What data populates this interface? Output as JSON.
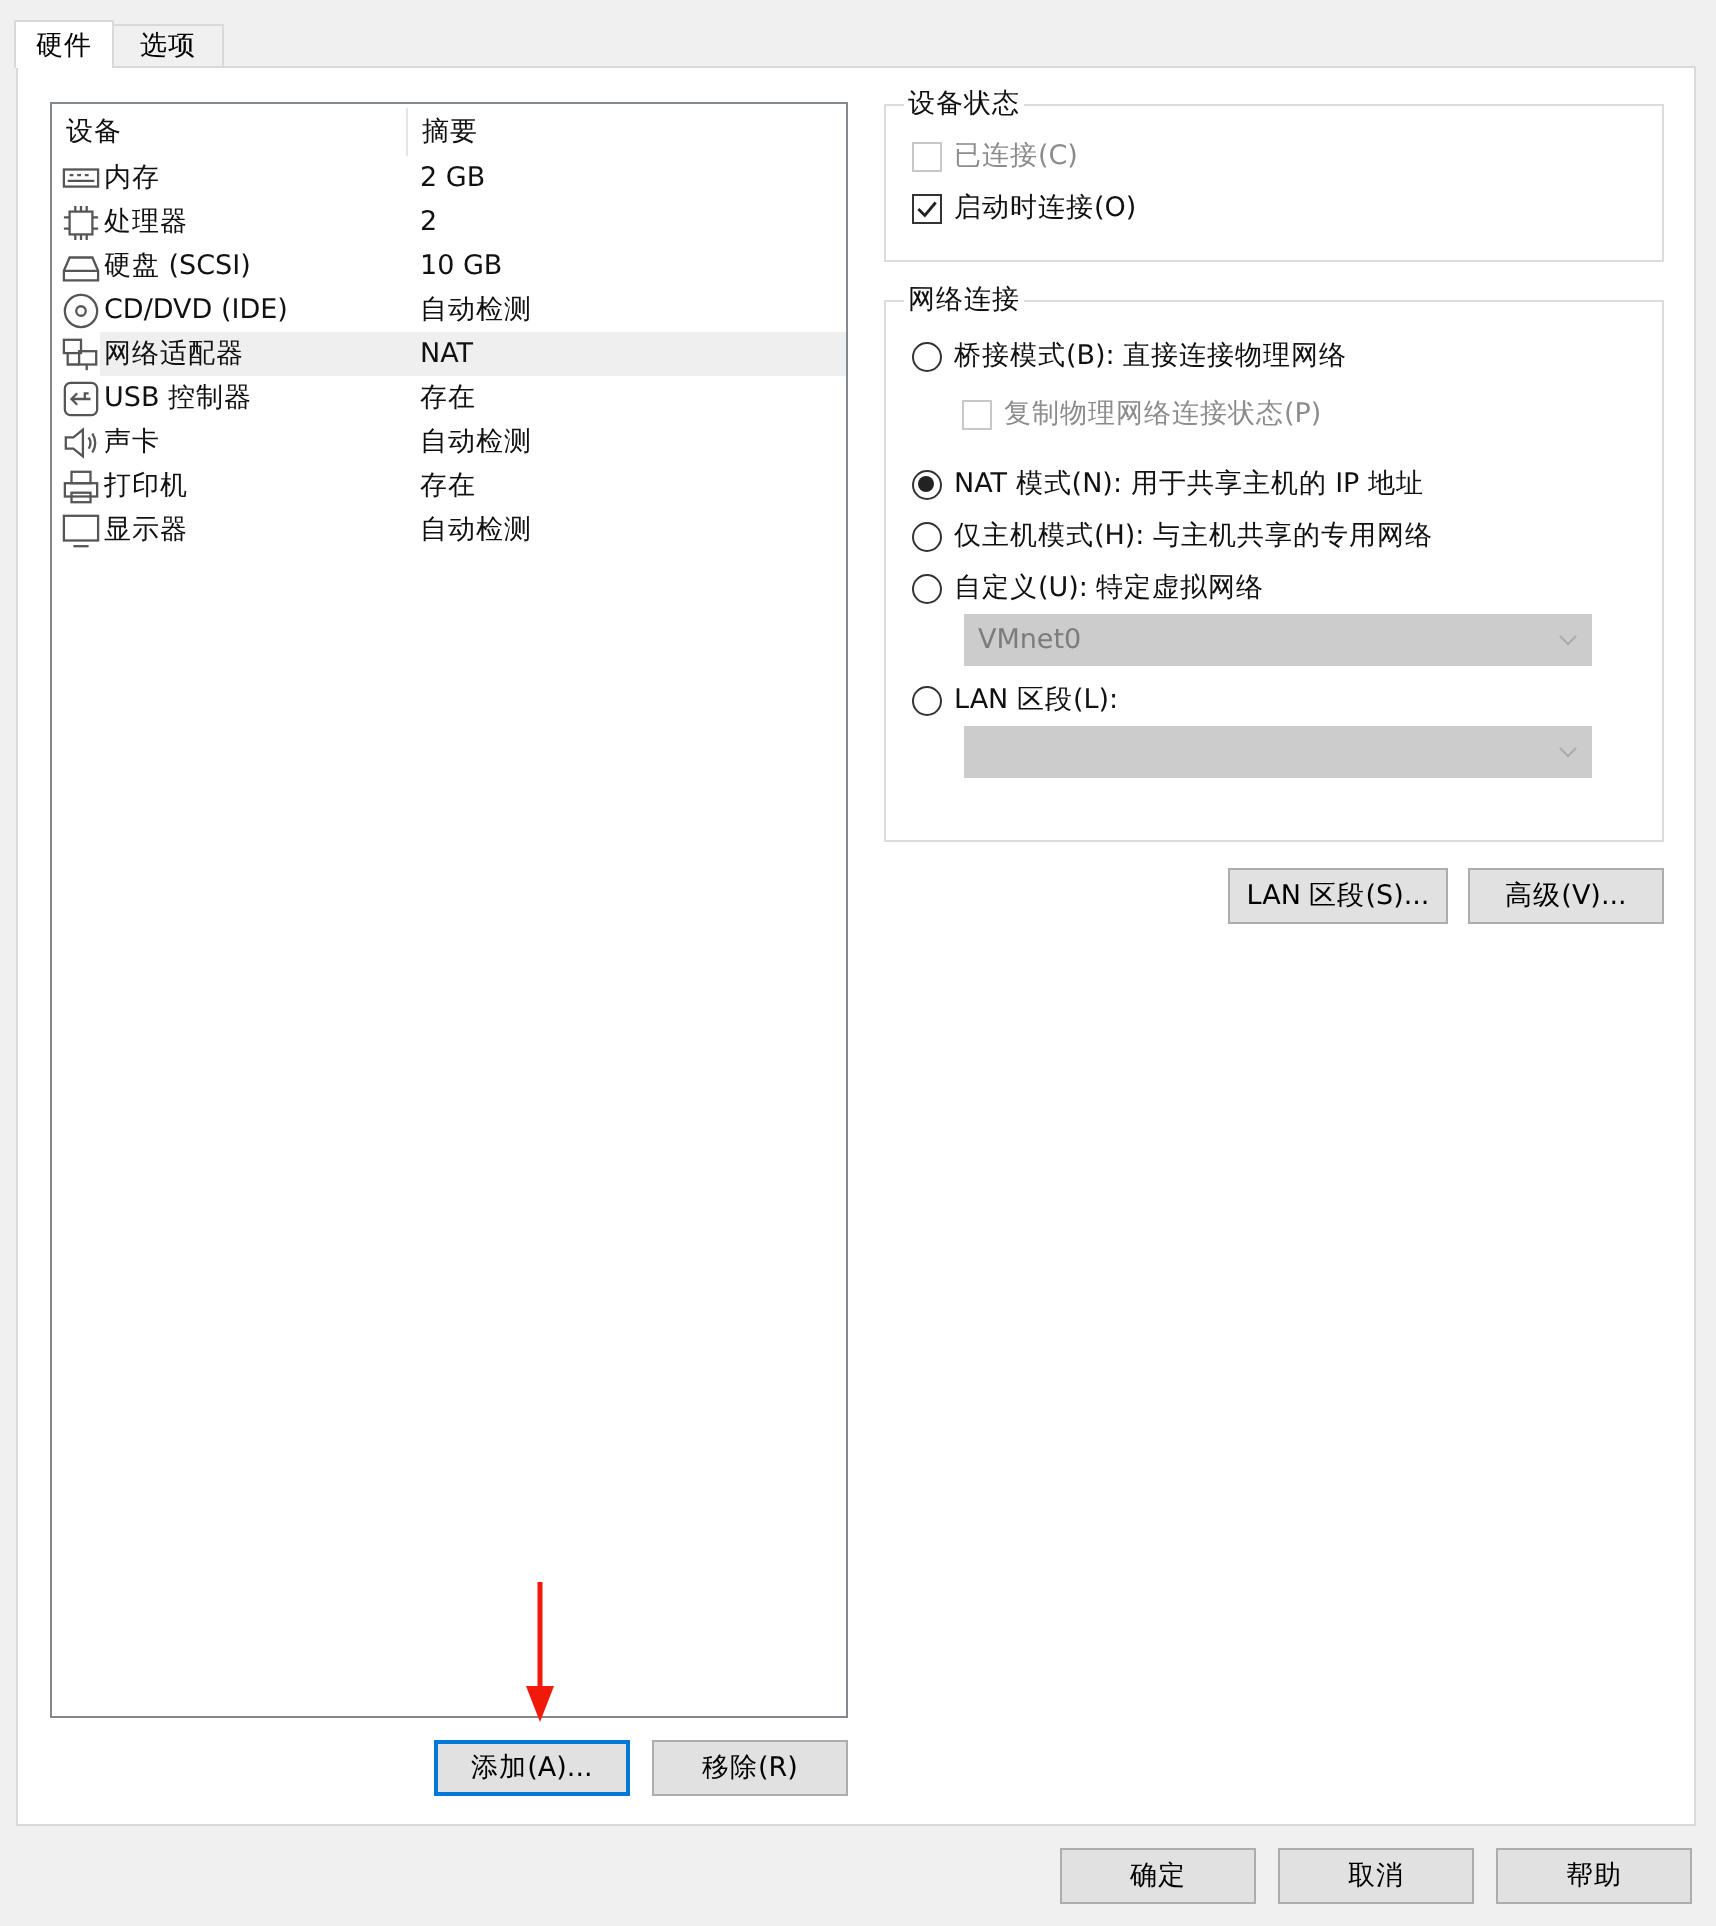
{
  "tabs": [
    {
      "label": "硬件",
      "selected": true
    },
    {
      "label": "选项",
      "selected": false
    }
  ],
  "devices": {
    "columns": [
      "设备",
      "摘要"
    ],
    "rows": [
      {
        "name": "内存",
        "summary": "2 GB",
        "selected": false
      },
      {
        "name": "处理器",
        "summary": "2",
        "selected": false
      },
      {
        "name": "硬盘 (SCSI)",
        "summary": "10 GB",
        "selected": false
      },
      {
        "name": "CD/DVD (IDE)",
        "summary": "自动检测",
        "selected": false
      },
      {
        "name": "网络适配器",
        "summary": "NAT",
        "selected": true
      },
      {
        "name": "USB 控制器",
        "summary": "存在",
        "selected": false
      },
      {
        "name": "声卡",
        "summary": "自动检测",
        "selected": false
      },
      {
        "name": "打印机",
        "summary": "存在",
        "selected": false
      },
      {
        "name": "显示器",
        "summary": "自动检测",
        "selected": false
      }
    ]
  },
  "list_buttons": [
    "添加(A)...",
    "移除(R)"
  ],
  "device_status": {
    "title": "设备状态",
    "options": [
      {
        "label": "已连接(C)",
        "checked": false,
        "disabled": true
      },
      {
        "label": "启动时连接(O)",
        "checked": true,
        "disabled": false
      }
    ]
  },
  "network": {
    "title": "网络连接",
    "options": [
      {
        "kind": "radio",
        "label": "桥接模式(B): 直接连接物理网络",
        "selected": false
      },
      {
        "kind": "checkbox",
        "label": "复制物理网络连接状态(P)",
        "checked": false,
        "disabled": true
      },
      {
        "kind": "radio",
        "label": "NAT 模式(N): 用于共享主机的 IP 地址",
        "selected": true
      },
      {
        "kind": "radio",
        "label": "仅主机模式(H): 与主机共享的专用网络",
        "selected": false
      },
      {
        "kind": "radio",
        "label": "自定义(U): 特定虚拟网络",
        "selected": false
      },
      {
        "kind": "select",
        "value": "VMnet0",
        "disabled": true
      },
      {
        "kind": "radio",
        "label": "LAN 区段(L):",
        "selected": false
      },
      {
        "kind": "select",
        "disabled": true
      }
    ]
  },
  "network_buttons": [
    "LAN 区段(S)...",
    "高级(V)..."
  ],
  "dialog_buttons": [
    "确定",
    "取消",
    "帮助"
  ]
}
